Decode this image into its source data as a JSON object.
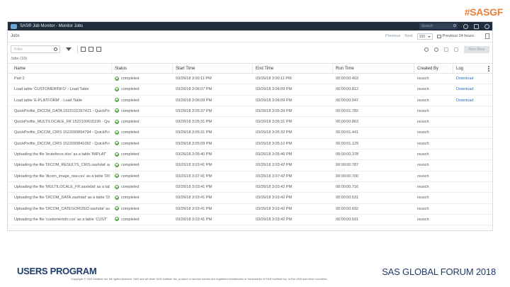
{
  "hashtag": "#SASGF",
  "app": {
    "title": "SAS® Job Monitor - Monitor Jobs",
    "search_placeholder": "Search"
  },
  "toolbar": {
    "section_label": "Jobs",
    "previous_label": "Previous",
    "next_label": "Next",
    "page_size": "100",
    "previous_hours_label": "Previous 24 hours"
  },
  "filter": {
    "placeholder": "Filter",
    "run_now_label": "Run Now"
  },
  "job_count": "Jobs (19)",
  "columns": {
    "name": "Name",
    "status": "Status",
    "start": "Start Time",
    "end": "End Time",
    "run": "Run Time",
    "by": "Created By",
    "log": "Log"
  },
  "rows": [
    {
      "name": "Part 2",
      "status": "completed",
      "start": "03/26/18 3:00:11 PM",
      "end": "03/26/18 3:00:11 PM",
      "run": "00:00:00.403",
      "by": "reusch",
      "log": "Download"
    },
    {
      "name": "Load table 'CUSTOMERINFO' - Load Table",
      "status": "completed",
      "start": "03/26/18 3:06:07 PM",
      "end": "03/26/18 3:06:09 PM",
      "run": "00:00:00.812",
      "by": "reusch",
      "log": "Download"
    },
    {
      "name": "Load table 'E-PLATFORM' - Load Table",
      "status": "completed",
      "start": "03/26/18 3:06:09 PM",
      "end": "03/26/18 3:06:09 PM",
      "run": "00:00:00.947",
      "by": "reusch",
      "log": "Download"
    },
    {
      "name": "QuickProfile_DICOM_DATA 1522102267421 - QuickProfile",
      "status": "completed",
      "start": "03/26/18 3:05:37 PM",
      "end": "03/26/18 3:05:39 PM",
      "run": "00:00:01.782",
      "by": "reusch",
      "log": ""
    },
    {
      "name": "QuickProfile_MULTILOCALE_FR 1522100615199 - QuickProfile",
      "status": "completed",
      "start": "03/26/18 3:05:31 PM",
      "end": "03/26/18 3:05:31 PM",
      "run": "00:00:00.863",
      "by": "reusch",
      "log": ""
    },
    {
      "name": "QuickProfile_DICOM_CRIS 1522099894794 - QuickProfile",
      "status": "completed",
      "start": "03/26/18 3:05:31 PM",
      "end": "03/26/18 3:05:32 PM",
      "run": "00:00:01.441",
      "by": "reusch",
      "log": ""
    },
    {
      "name": "QuickProfile_DICOM_CRIS 1522099841092 - QuickProfile",
      "status": "completed",
      "start": "03/26/18 3:05:09 PM",
      "end": "03/26/18 3:05:10 PM",
      "run": "00:00:01.129",
      "by": "reusch",
      "log": ""
    },
    {
      "name": "Uploading the file 'bruteforce.xlsx' as a table 'IMPLAT'",
      "status": "completed",
      "start": "03/26/18 3:05:40 PM",
      "end": "03/26/18 3:05:40 PM",
      "run": "00:00:00.378",
      "by": "reusch",
      "log": ""
    },
    {
      "name": "Uploading the file 'DICOM_RESULTS_CRIS.sashdat' as a table",
      "status": "completed",
      "start": "03/26/18 3:03:41 PM",
      "end": "03/26/18 3:03:42 PM",
      "run": "00:00:00.787",
      "by": "reusch",
      "log": ""
    },
    {
      "name": "Uploading the file 'dicom_image_raw.csv' as a table 'DICOM'",
      "status": "completed",
      "start": "03/26/18 3:07:41 PM",
      "end": "03/26/18 3:07:42 PM",
      "run": "00:00:00.700",
      "by": "reusch",
      "log": ""
    },
    {
      "name": "Uploading the file 'MULTILOCALE_FR.sashdat' as a table",
      "status": "completed",
      "start": "03/26/18 3:03:41 PM",
      "end": "03/26/18 3:03:42 PM",
      "run": "00:00:00.716",
      "by": "reusch",
      "log": ""
    },
    {
      "name": "Uploading the file 'DICOM_DATA.sashdat' as a table 'DICOM'",
      "status": "completed",
      "start": "03/26/18 3:03:41 PM",
      "end": "03/26/18 3:03:42 PM",
      "run": "00:00:00.531",
      "by": "reusch",
      "log": ""
    },
    {
      "name": "Uploading the file 'DICOM_CATEGORIZED.sashdat' as a table",
      "status": "completed",
      "start": "03/26/18 3:03:41 PM",
      "end": "03/26/18 3:03:42 PM",
      "run": "00:00:00.692",
      "by": "reusch",
      "log": ""
    },
    {
      "name": "Uploading the file 'customerinfo.csv' as a table 'CUST'",
      "status": "completed",
      "start": "03/26/18 3:03:41 PM",
      "end": "03/26/18 3:03:42 PM",
      "run": "00:00:00.591",
      "by": "reusch",
      "log": ""
    }
  ],
  "footer": {
    "left": "USERS PROGRAM",
    "brand": "SAS",
    "event": "GLOBAL FORUM 2018",
    "copyright": "Copyright © SAS Institute Inc. All rights reserved. SAS and all other SAS Institute Inc. product or service names are registered trademarks or trademarks of SAS Institute Inc. in the USA and other countries."
  }
}
